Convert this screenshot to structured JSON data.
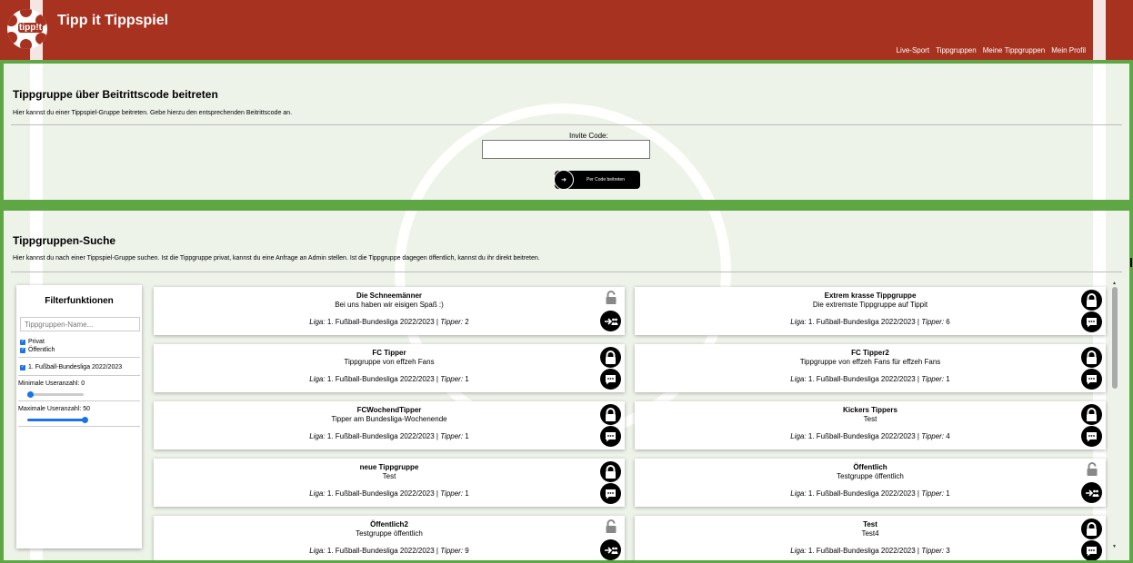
{
  "app": {
    "title": "Tipp it Tippspiel",
    "logo_text": "tipp!t"
  },
  "nav": [
    {
      "label": "Live-Sport"
    },
    {
      "label": "Tippgruppen"
    },
    {
      "label": "Meine Tippgruppen"
    },
    {
      "label": "Mein Profil"
    }
  ],
  "join": {
    "title": "Tippgruppe über Beitrittscode beitreten",
    "description": "Hier kannst du einer Tippspiel-Gruppe beitreten. Gebe hierzu den entsprechenden Beitrittscode an.",
    "input_label": "Invite Code:",
    "input_value": "",
    "button_label": "Per Code beitreten"
  },
  "search": {
    "title": "Tippgruppen-Suche",
    "description": "Hier kannst du nach einer Tippspiel-Gruppe suchen. Ist die Tippgruppe privat, kannst du eine Anfrage an Admin stellen. Ist die Tippgruppe dagegen öffentlich, kannst du ihr direkt beitreten."
  },
  "filter": {
    "title": "Filterfunktionen",
    "name_placeholder": "Tippgruppen-Name...",
    "checkboxes": [
      "Privat",
      "Öffentlich"
    ],
    "league": "1. Fußball-Bundesliga 2022/2023",
    "min_label": "Minimale Useranzahl: 0",
    "max_label": "Maximale Useranzahl: 50",
    "min_value": 0,
    "max_value": 50
  },
  "liga_label": "Liga:",
  "tipper_label": "Tipper:",
  "cards": [
    {
      "name": "Die Schneemänner",
      "desc": "Bei uns haben wir eisigen Spaß :)",
      "liga": "1. Fußball-Bundesliga 2022/2023",
      "tipper": "2",
      "type": "public"
    },
    {
      "name": "Extrem krasse Tippgruppe",
      "desc": "Die extremste Tippgruppe auf Tippit",
      "liga": "1. Fußball-Bundesliga 2022/2023",
      "tipper": "6",
      "type": "private"
    },
    {
      "name": "FC Tipper",
      "desc": "Tippgruppe von effzeh Fans",
      "liga": "1. Fußball-Bundesliga 2022/2023",
      "tipper": "1",
      "type": "private"
    },
    {
      "name": "FC Tipper2",
      "desc": "Tippgruppe von effzeh Fans für effzeh Fans",
      "liga": "1. Fußball-Bundesliga 2022/2023",
      "tipper": "1",
      "type": "private"
    },
    {
      "name": "FCWochendTipper",
      "desc": "Tipper am Bundesliga-Wochenende",
      "liga": "1. Fußball-Bundesliga 2022/2023",
      "tipper": "1",
      "type": "private"
    },
    {
      "name": "Kickers Tippers",
      "desc": "Test",
      "liga": "1. Fußball-Bundesliga 2022/2023",
      "tipper": "4",
      "type": "private"
    },
    {
      "name": "neue Tippgruppe",
      "desc": "Test",
      "liga": "1. Fußball-Bundesliga 2022/2023",
      "tipper": "1",
      "type": "private"
    },
    {
      "name": "Öffentlich",
      "desc": "Testgruppe öffentlich",
      "liga": "1. Fußball-Bundesliga 2022/2023",
      "tipper": "1",
      "type": "public"
    },
    {
      "name": "Öffentlich2",
      "desc": "Testgruppe öffentlich",
      "liga": "1. Fußball-Bundesliga 2022/2023",
      "tipper": "9",
      "type": "public"
    },
    {
      "name": "Test",
      "desc": "Test4",
      "liga": "1. Fußball-Bundesliga 2022/2023",
      "tipper": "3",
      "type": "private"
    }
  ]
}
